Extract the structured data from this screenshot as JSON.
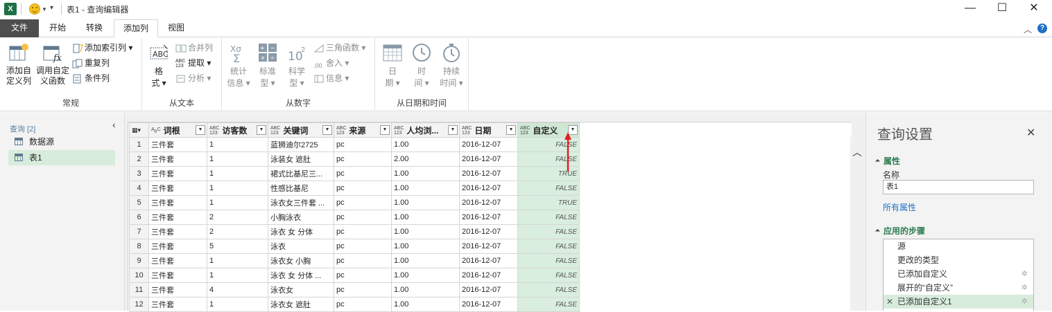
{
  "window": {
    "title": "表1 - 查询编辑器",
    "app_icon": "excel-icon"
  },
  "ribbon_tabs": [
    {
      "label": "文件"
    },
    {
      "label": "开始"
    },
    {
      "label": "转换"
    },
    {
      "label": "添加列"
    },
    {
      "label": "视图"
    }
  ],
  "ribbon": {
    "groups": {
      "general": "常规",
      "from_text": "从文本",
      "from_number": "从数字",
      "from_datetime": "从日期和时间"
    },
    "add_custom_column": "添加自\n定义列",
    "invoke_custom_function": "调用自定\n义函数",
    "add_index_column": "添加索引列",
    "duplicate_column": "重复列",
    "conditional_column": "条件列",
    "format": "格\n式",
    "merge_columns": "合并列",
    "extract": "提取",
    "parse": "分析",
    "statistics": "统计\n信息",
    "standard": "标准\n型",
    "scientific": "科学\n型",
    "trigonometry": "三角函数",
    "rounding": "舍入",
    "information": "信息",
    "date": "日\n期",
    "time": "时\n间",
    "duration": "持续\n时间"
  },
  "left_pane": {
    "header": "查询 [2]",
    "queries": [
      {
        "name": "数据源"
      },
      {
        "name": "表1"
      }
    ]
  },
  "grid": {
    "columns": [
      {
        "type": "ABC",
        "name": "词根"
      },
      {
        "type": "ABC 123",
        "name": "访客数"
      },
      {
        "type": "ABC 123",
        "name": "关键词"
      },
      {
        "type": "ABC 123",
        "name": "来源"
      },
      {
        "type": "ABC 123",
        "name": "人均浏..."
      },
      {
        "type": "ABC 123",
        "name": "日期"
      },
      {
        "type": "ABC 123",
        "name": "自定义"
      }
    ],
    "rows": [
      [
        "1",
        "三件套",
        "1",
        "蓝狮迪尔2725",
        "pc",
        "1.00",
        "2016-12-07",
        "FALSE"
      ],
      [
        "2",
        "三件套",
        "1",
        "泳装女 遮肚",
        "pc",
        "2.00",
        "2016-12-07",
        "FALSE"
      ],
      [
        "3",
        "三件套",
        "1",
        "裙式比基尼三...",
        "pc",
        "1.00",
        "2016-12-07",
        "TRUE"
      ],
      [
        "4",
        "三件套",
        "1",
        "性感比基尼",
        "pc",
        "1.00",
        "2016-12-07",
        "FALSE"
      ],
      [
        "5",
        "三件套",
        "1",
        "泳衣女三件套 ...",
        "pc",
        "1.00",
        "2016-12-07",
        "TRUE"
      ],
      [
        "6",
        "三件套",
        "2",
        "小胸泳衣",
        "pc",
        "1.00",
        "2016-12-07",
        "FALSE"
      ],
      [
        "7",
        "三件套",
        "2",
        "泳衣 女 分体",
        "pc",
        "1.00",
        "2016-12-07",
        "FALSE"
      ],
      [
        "8",
        "三件套",
        "5",
        "泳衣",
        "pc",
        "1.00",
        "2016-12-07",
        "FALSE"
      ],
      [
        "9",
        "三件套",
        "1",
        "泳衣女 小胸",
        "pc",
        "1.00",
        "2016-12-07",
        "FALSE"
      ],
      [
        "10",
        "三件套",
        "1",
        "泳衣 女 分体 ...",
        "pc",
        "1.00",
        "2016-12-07",
        "FALSE"
      ],
      [
        "11",
        "三件套",
        "4",
        "泳衣女",
        "pc",
        "1.00",
        "2016-12-07",
        "FALSE"
      ],
      [
        "12",
        "三件套",
        "1",
        "泳衣女 遮肚",
        "pc",
        "1.00",
        "2016-12-07",
        "FALSE"
      ]
    ]
  },
  "right_pane": {
    "title": "查询设置",
    "properties_header": "属性",
    "name_label": "名称",
    "name_value": "表1",
    "all_properties": "所有属性",
    "steps_header": "应用的步骤",
    "steps": [
      {
        "label": "源"
      },
      {
        "label": "更改的类型"
      },
      {
        "label": "已添加自定义"
      },
      {
        "label": "展开的“自定义”"
      },
      {
        "label": "已添加自定义1"
      }
    ]
  },
  "colors": {
    "accent_green": "#2e7d50",
    "selection_green": "#d8ecdc",
    "file_tab": "#4e4e4e",
    "excel_brand": "#1e7145"
  }
}
